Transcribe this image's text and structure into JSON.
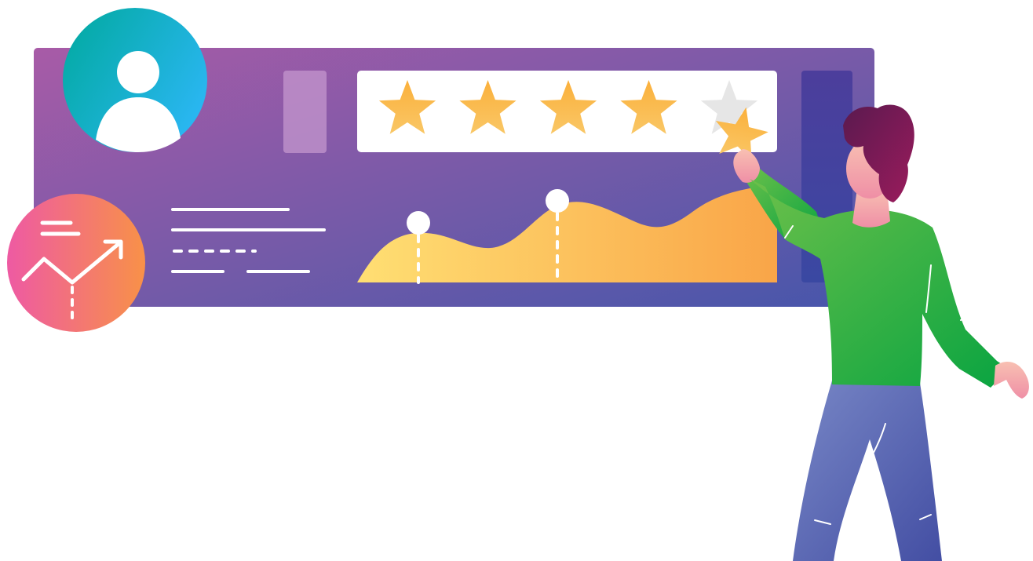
{
  "illustration": {
    "rating": {
      "filled": 4,
      "total": 5,
      "star_icon": "star-icon"
    },
    "icons": {
      "profile": "user-avatar-icon",
      "analytics": "trend-chart-icon"
    },
    "colors": {
      "panel_start": "#a75aa6",
      "panel_end": "#4a57ab",
      "star_gold": "#fbb03b",
      "star_empty": "#e6e6e6",
      "avatar_start": "#00a99d",
      "avatar_end": "#29abe2",
      "trend_start": "#ee5aa0",
      "trend_end": "#f7934a",
      "wave_start": "#ffdc70",
      "wave_end": "#f9a84a",
      "shirt": "#3fbb4a",
      "pants": "#5562b0",
      "hair": "#7b1e56",
      "skin": "#f7a8a8"
    }
  }
}
